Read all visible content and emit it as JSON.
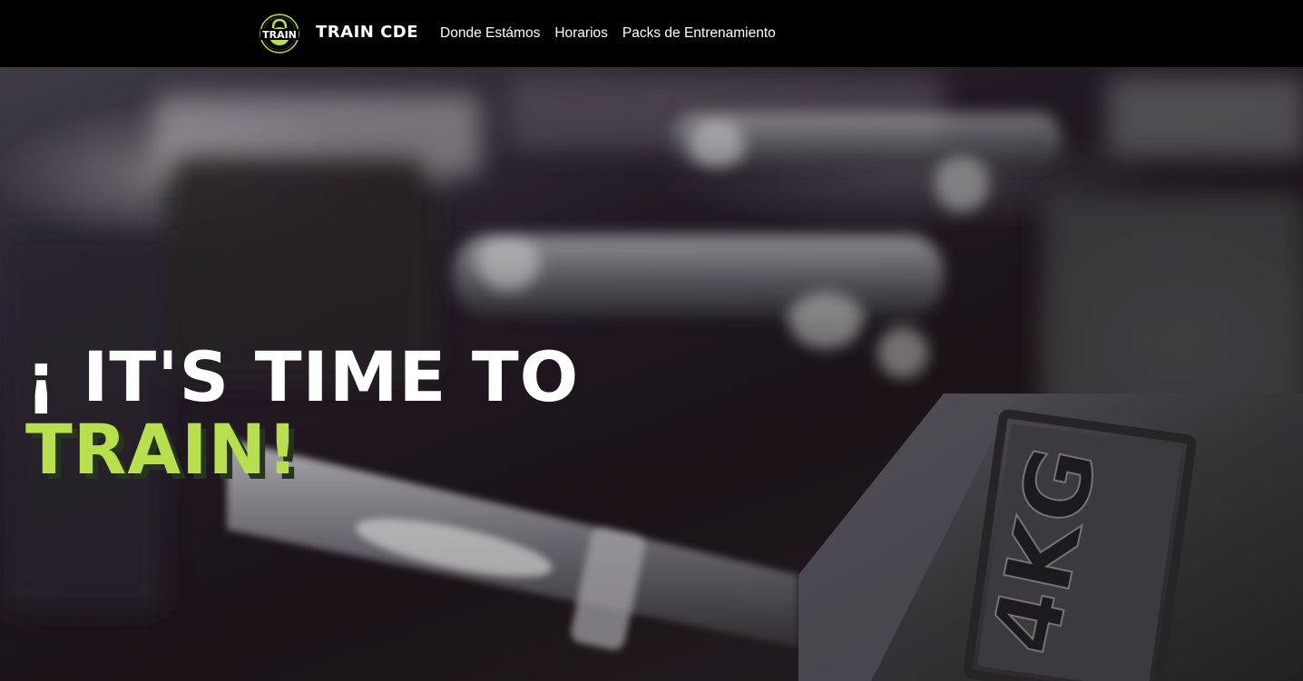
{
  "navbar": {
    "logo_text": "TRAIN",
    "brand": "TRAIN CDE",
    "links": [
      {
        "label": "Donde Estámos"
      },
      {
        "label": "Horarios"
      },
      {
        "label": "Packs de Entrenamiento"
      }
    ]
  },
  "hero": {
    "headline_line1": "¡ IT'S TIME TO",
    "headline_line2": "TRAIN!",
    "dumbbell_label": "4KG"
  },
  "colors": {
    "accent": "#b8df4e",
    "navbar_bg": "#000000"
  }
}
